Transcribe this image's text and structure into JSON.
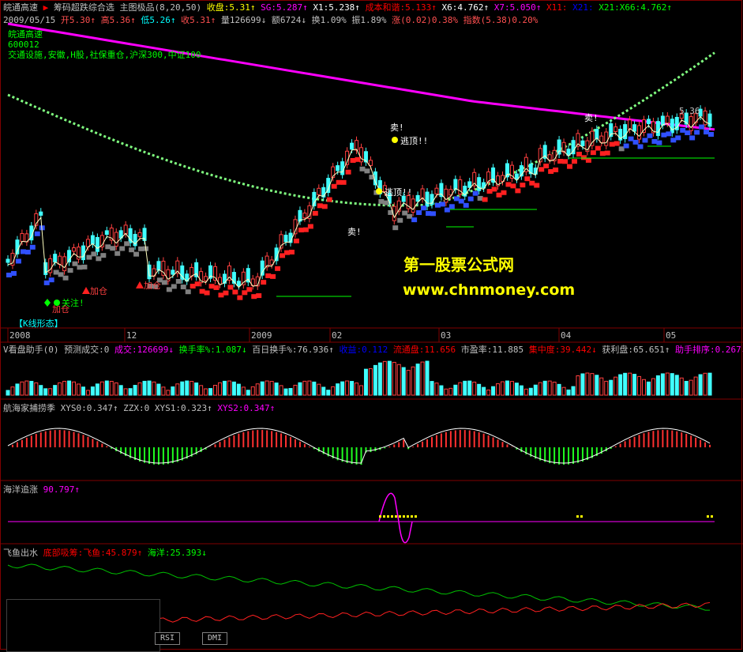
{
  "header1": [
    {
      "t": "皖通高速",
      "c": "#c0c0c0"
    },
    {
      "t": "▶",
      "c": "#ff0000"
    },
    {
      "t": "筹码超跌综合选",
      "c": "#c0c0c0"
    },
    {
      "t": "主图极品(8,20,50)",
      "c": "#c0c0c0"
    },
    {
      "t": "收盘:5.31↑",
      "c": "#ffff00"
    },
    {
      "t": "SG:5.287↑",
      "c": "#ff00ff"
    },
    {
      "t": "X1:5.238↑",
      "c": "#ffffff"
    },
    {
      "t": "成本和谐:5.133↑",
      "c": "#ff0000"
    },
    {
      "t": "X6:4.762↑",
      "c": "#ffffff"
    },
    {
      "t": "X7:5.050↑",
      "c": "#ff00ff"
    },
    {
      "t": "X11:",
      "c": "#ff0000"
    },
    {
      "t": "X21:",
      "c": "#0000ff"
    },
    {
      "t": "X21:X66:4.762↑",
      "c": "#00ff00"
    }
  ],
  "header2": [
    {
      "t": "2009/05/15",
      "c": "#c0c0c0"
    },
    {
      "t": "开5.30↑",
      "c": "#ff5050"
    },
    {
      "t": "高5.36↑",
      "c": "#ff5050"
    },
    {
      "t": "低5.26↑",
      "c": "#00ffff"
    },
    {
      "t": "收5.31↑",
      "c": "#ff5050"
    },
    {
      "t": "量126699↓",
      "c": "#c0c0c0"
    },
    {
      "t": "额6724↓",
      "c": "#c0c0c0"
    },
    {
      "t": "换1.09%",
      "c": "#c0c0c0"
    },
    {
      "t": "振1.89%",
      "c": "#c0c0c0"
    },
    {
      "t": "涨(0.02)0.38%",
      "c": "#ff5050"
    },
    {
      "t": "指数(5.38)0.20%",
      "c": "#ff5050"
    }
  ],
  "stock_info": {
    "name": "皖通高速",
    "code": "600012",
    "sector": "交通设施,安徽,H股,社保重仓,沪深300,中证100"
  },
  "price_label": "5.36",
  "annotations": {
    "sell": "卖!",
    "escape_top": "逃顶!!",
    "add_pos": "加仓",
    "watch": "关注!",
    "k_line": "【K线形态】"
  },
  "watermark": {
    "line1": "第一股票公式网",
    "line2": "www.chnmoney.com"
  },
  "date_axis": [
    "2008",
    "12",
    "2009",
    "02",
    "03",
    "04",
    "05"
  ],
  "vol_panel": [
    {
      "t": "V看盘助手(0)",
      "c": "#c0c0c0"
    },
    {
      "t": "预测成交:0",
      "c": "#c0c0c0"
    },
    {
      "t": "成交:126699↓",
      "c": "#ff00ff"
    },
    {
      "t": "换手率%:1.087↓",
      "c": "#00ff00"
    },
    {
      "t": "百日换手%:76.936↑",
      "c": "#c0c0c0"
    },
    {
      "t": "收益:0.112",
      "c": "#0000ff"
    },
    {
      "t": "流通盘:11.656",
      "c": "#ff0000"
    },
    {
      "t": "市盈率:11.885",
      "c": "#c0c0c0"
    },
    {
      "t": "集中度:39.442↓",
      "c": "#ff0000"
    },
    {
      "t": "获利盘:65.651↑",
      "c": "#c0c0c0"
    },
    {
      "t": "助手排序:0.267↓",
      "c": "#ff00ff"
    }
  ],
  "ind1_panel": [
    {
      "t": "航海家捕捞季",
      "c": "#c0c0c0"
    },
    {
      "t": "XYS0:0.347↑",
      "c": "#c0c0c0"
    },
    {
      "t": "ZZX:0",
      "c": "#c0c0c0"
    },
    {
      "t": "XYS1:0.323↑",
      "c": "#c0c0c0"
    },
    {
      "t": "XYS2:0.347↑",
      "c": "#ff00ff"
    }
  ],
  "ind2_panel": [
    {
      "t": "海洋追涨",
      "c": "#c0c0c0"
    },
    {
      "t": "90.797↑",
      "c": "#ff00ff"
    }
  ],
  "ind3_panel": [
    {
      "t": "飞鱼出水",
      "c": "#c0c0c0"
    },
    {
      "t": "底部吸筹:飞鱼:45.879↑",
      "c": "#ff0000"
    },
    {
      "t": "海洋:25.393↓",
      "c": "#00ff00"
    }
  ],
  "tabs": [
    "RSI",
    "DMI"
  ],
  "colors": {
    "up": "#ff4040",
    "down": "#40ffff",
    "ma_long": "#ff00ff",
    "vol_up": "#ff4040",
    "vol_down": "#40ffff"
  }
}
